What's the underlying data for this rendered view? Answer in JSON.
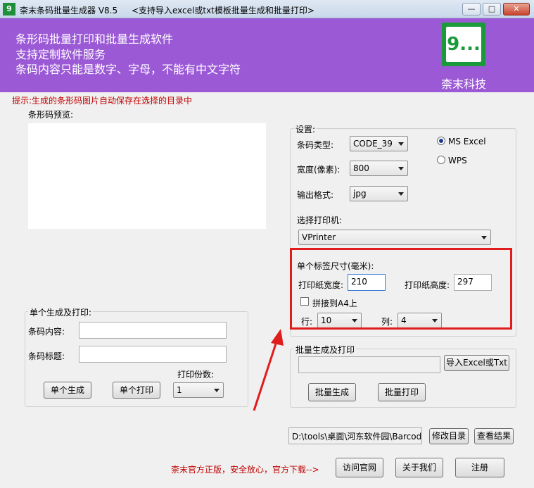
{
  "window": {
    "app_icon": "9",
    "title": "柰末条码批量生成器 V8.5",
    "subtitle": "<支持导入excel或txt模板批量生成和批量打印>",
    "buttons": {
      "minimize": "—",
      "maximize": "□",
      "close": "✕"
    }
  },
  "banner": {
    "lines": [
      "条形码批量打印和批量生成软件",
      "支持定制软件服务",
      "条码内容只能是数字、字母，不能有中文字符"
    ],
    "logo_glyph": "9...",
    "company": "柰末科技",
    "bg_color": "#9b59d6"
  },
  "hint": "提示:生成的条形码图片自动保存在选择的目录中",
  "preview": {
    "label": "条形码预览:"
  },
  "single": {
    "group_label": "单个生成及打印:",
    "content_label": "条码内容:",
    "content_value": "",
    "title_label": "条码标题:",
    "title_value": "",
    "copies_label": "打印份数:",
    "copies_value": "1",
    "generate_button": "单个生成",
    "print_button": "单个打印"
  },
  "settings": {
    "group_label": "设置:",
    "type_label": "条码类型:",
    "type_value": "CODE_39",
    "width_label": "宽度(像素):",
    "width_value": "800",
    "format_label": "输出格式:",
    "format_value": "jpg",
    "radio_excel": "MS  Excel",
    "radio_wps": "WPS",
    "radio_selected": "excel",
    "printer_label": "选择打印机:",
    "printer_value": "VPrinter",
    "label_size": "单个标签尺寸(毫米):",
    "paper_width_label": "打印纸宽度:",
    "paper_width_value": "210",
    "paper_height_label": "打印纸高度:",
    "paper_height_value": "297",
    "a4_label": "拼接到A4上",
    "a4_checked": false,
    "rows_label": "行:",
    "rows_value": "10",
    "cols_label": "列:",
    "cols_value": "4"
  },
  "batch": {
    "group_label": "批量生成及打印",
    "file_value": "",
    "import_button": "导入Excel或Txt",
    "generate_button": "批量生成",
    "print_button": "批量打印"
  },
  "output": {
    "path_value": "D:\\tools\\桌面\\河东软件园\\Barcode",
    "change_button": "修改目录",
    "view_button": "查看结果"
  },
  "footer": {
    "text": "柰末官方正版，安全放心，官方下载-->",
    "visit_button": "访问官网",
    "about_button": "关于我们",
    "register_button": "注册"
  },
  "highlight_color": "#e01c1c"
}
